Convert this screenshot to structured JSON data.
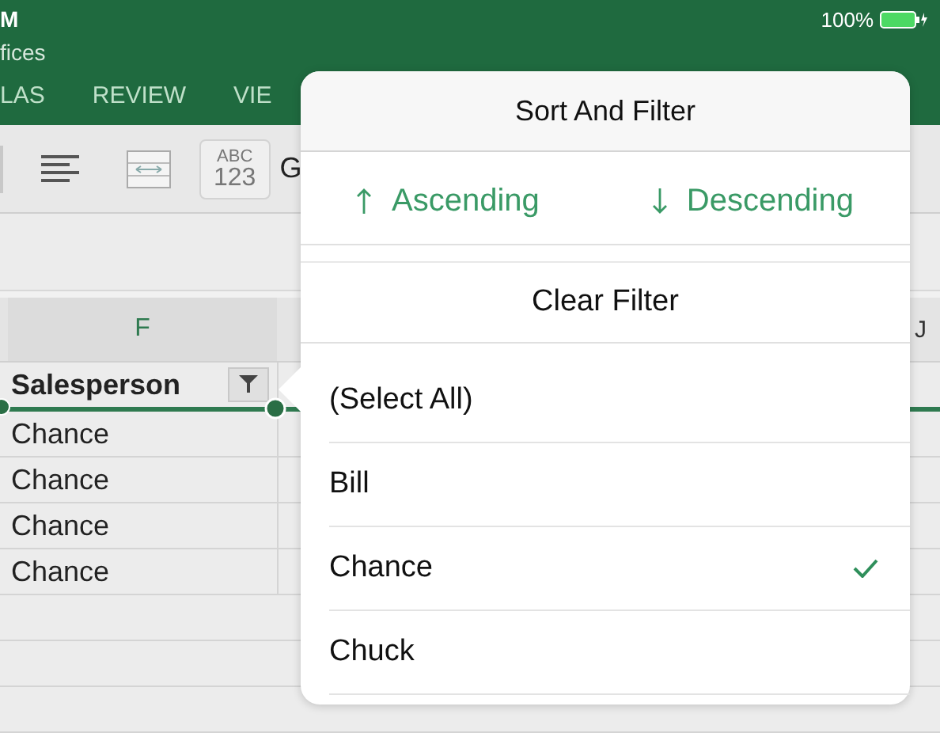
{
  "status_bar": {
    "time": "M",
    "battery": "100%"
  },
  "app": {
    "subtitle": "fices"
  },
  "ribbon_tabs": [
    {
      "label": "LAS"
    },
    {
      "label": "REVIEW"
    },
    {
      "label": "VIE"
    }
  ],
  "toolbar": {
    "number_format": [
      "ABC",
      "123"
    ],
    "font_label": "G"
  },
  "sheet": {
    "column_headers": [
      "F",
      "J"
    ],
    "header_cell": "Salesperson",
    "rows": [
      "Chance",
      "Chance",
      "Chance",
      "Chance"
    ]
  },
  "popover": {
    "title": "Sort And Filter",
    "sort": [
      {
        "kind": "ascending",
        "label": "Ascending"
      },
      {
        "kind": "descending",
        "label": "Descending"
      }
    ],
    "clear": "Clear Filter",
    "items": [
      {
        "label": "(Select All)",
        "checked": false
      },
      {
        "label": "Bill",
        "checked": false
      },
      {
        "label": "Chance",
        "checked": true
      },
      {
        "label": "Chuck",
        "checked": false
      }
    ]
  }
}
